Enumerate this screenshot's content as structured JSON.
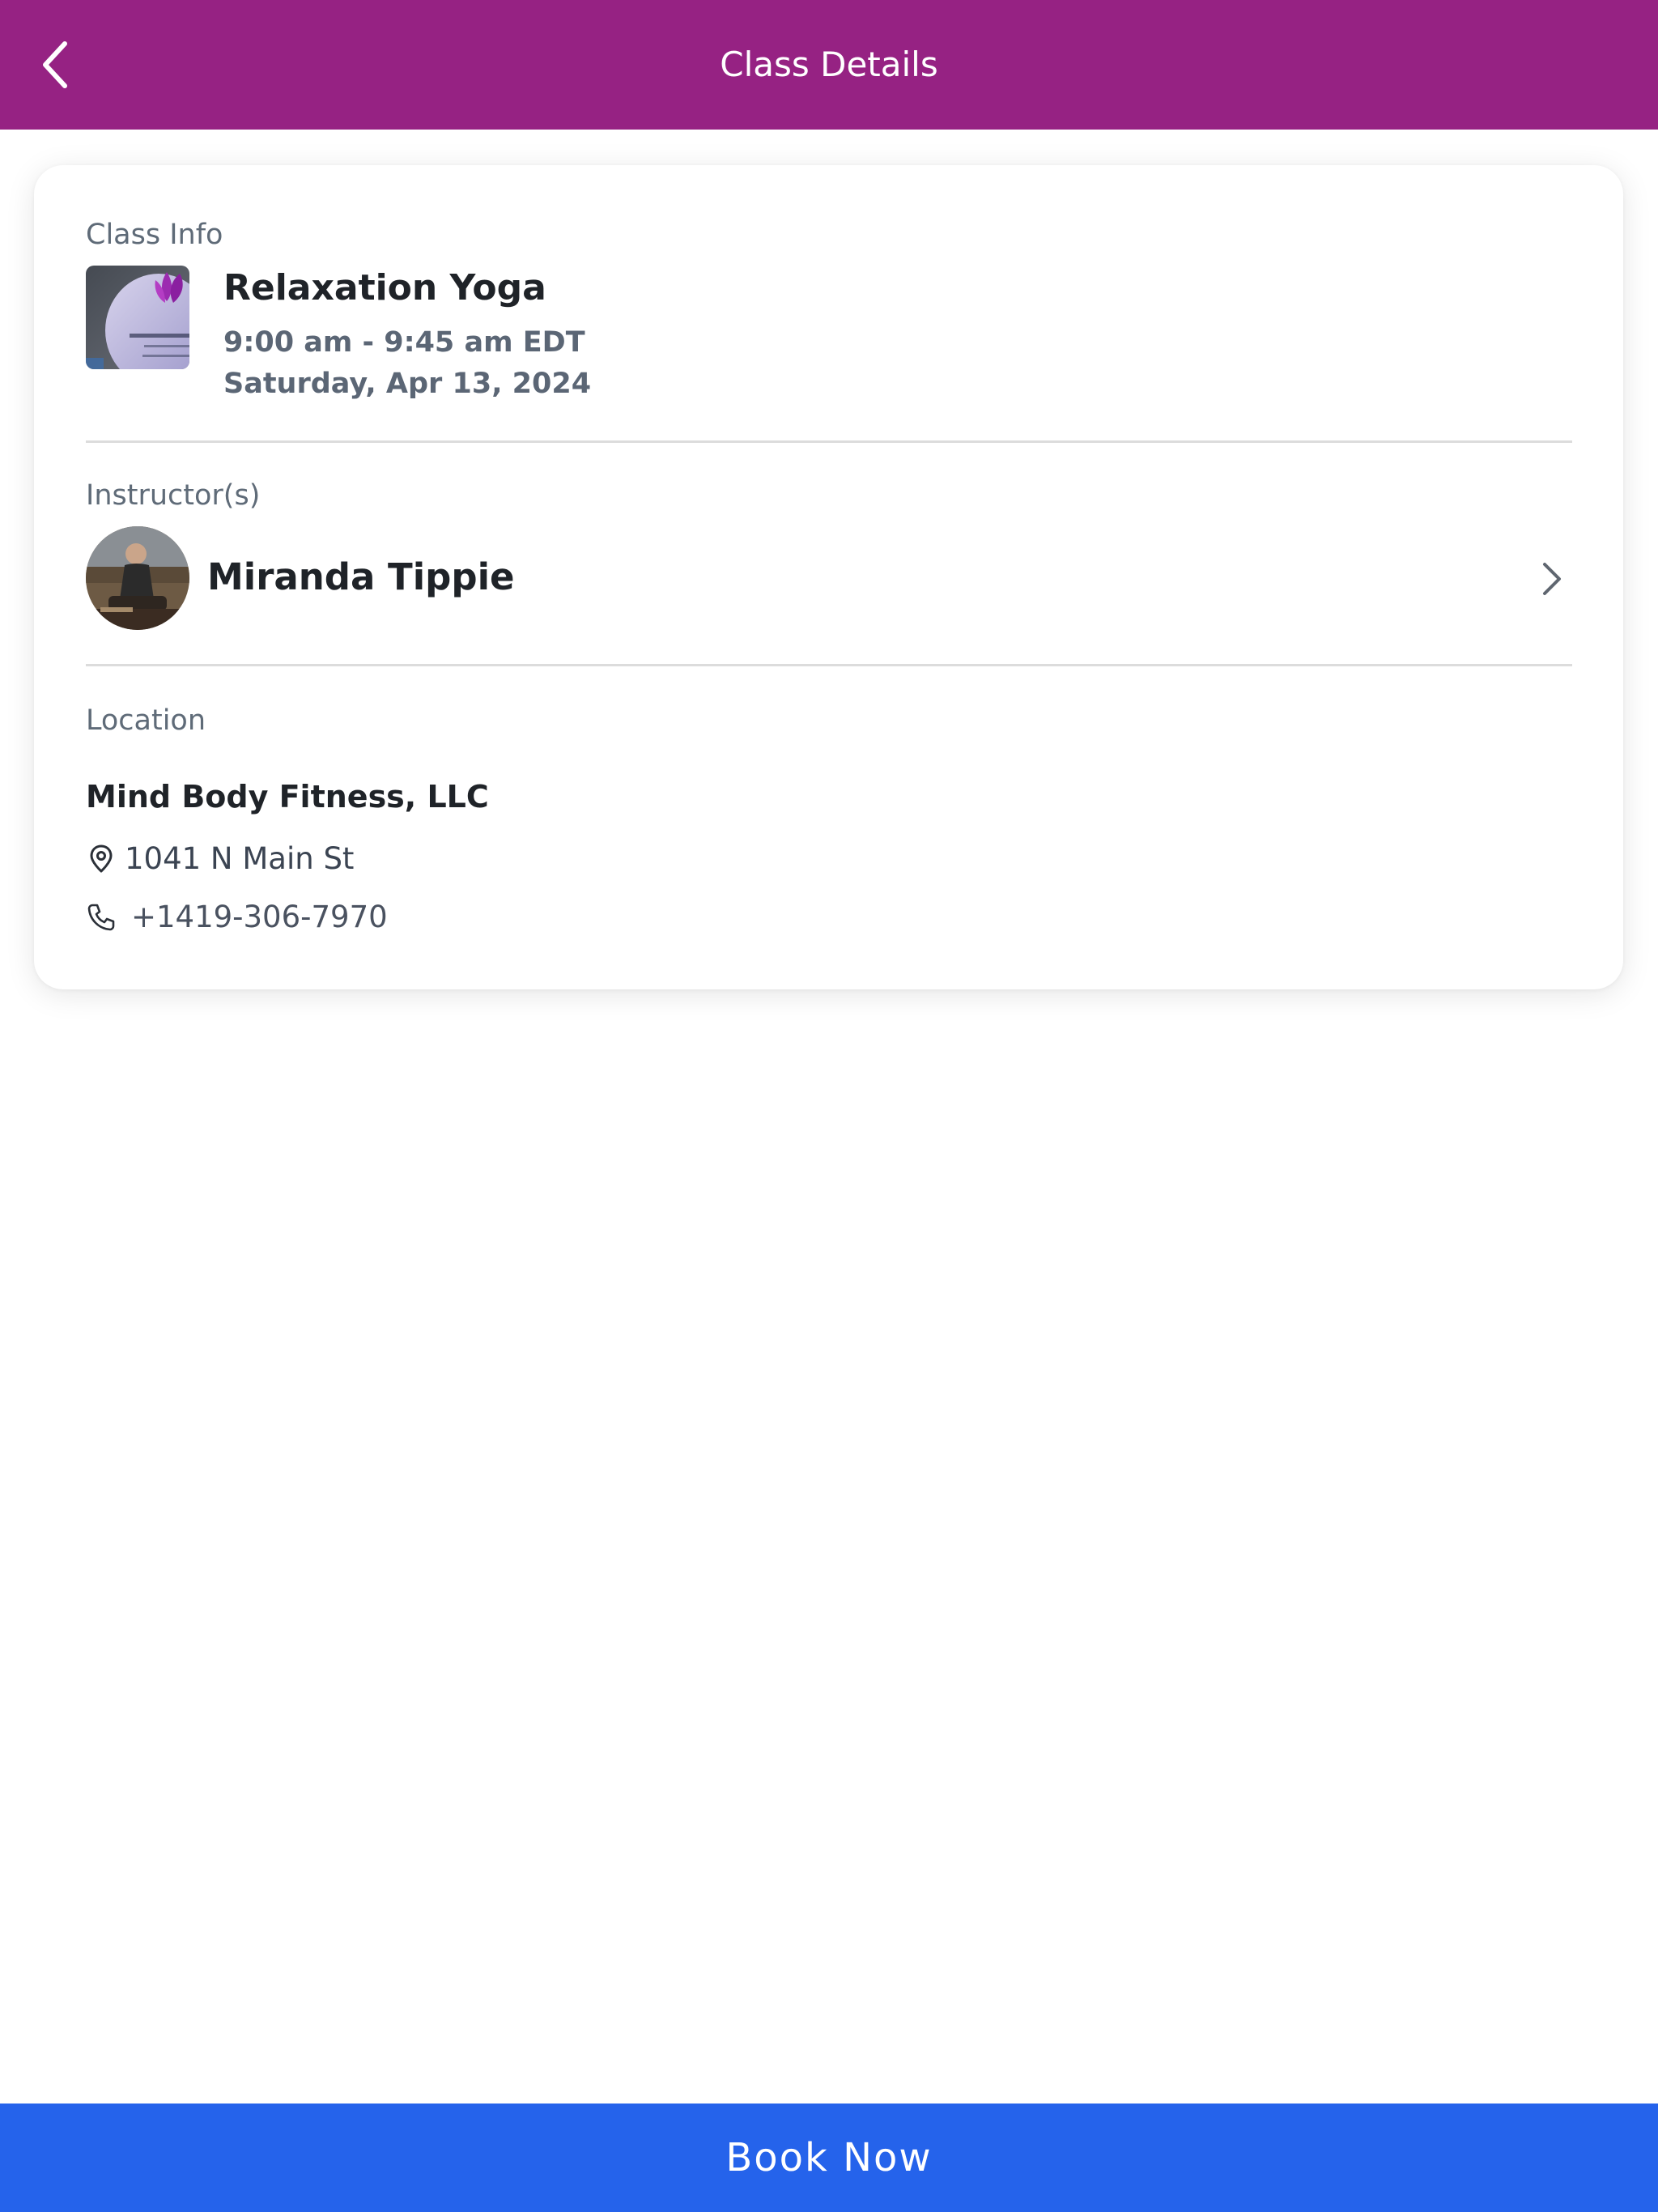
{
  "header": {
    "title": "Class Details",
    "back_icon": "chevron-left-icon",
    "background_color": "#962283"
  },
  "class_info": {
    "section_label": "Class Info",
    "thumbnail_image": "class-logo-image",
    "name": "Relaxation Yoga",
    "time": "9:00 am - 9:45 am EDT",
    "date": "Saturday, Apr 13, 2024"
  },
  "instructors": {
    "section_label": "Instructor(s)",
    "items": [
      {
        "name": "Miranda Tippie",
        "avatar": "instructor-avatar"
      }
    ],
    "chevron_icon": "chevron-right-icon"
  },
  "location": {
    "section_label": "Location",
    "name": "Mind Body Fitness, LLC",
    "address": "1041 N Main St",
    "address_icon": "map-pin-icon",
    "phone": "+1419-306-7970",
    "phone_icon": "phone-icon"
  },
  "footer": {
    "book_button_label": "Book Now",
    "button_color": "#2563eb"
  }
}
